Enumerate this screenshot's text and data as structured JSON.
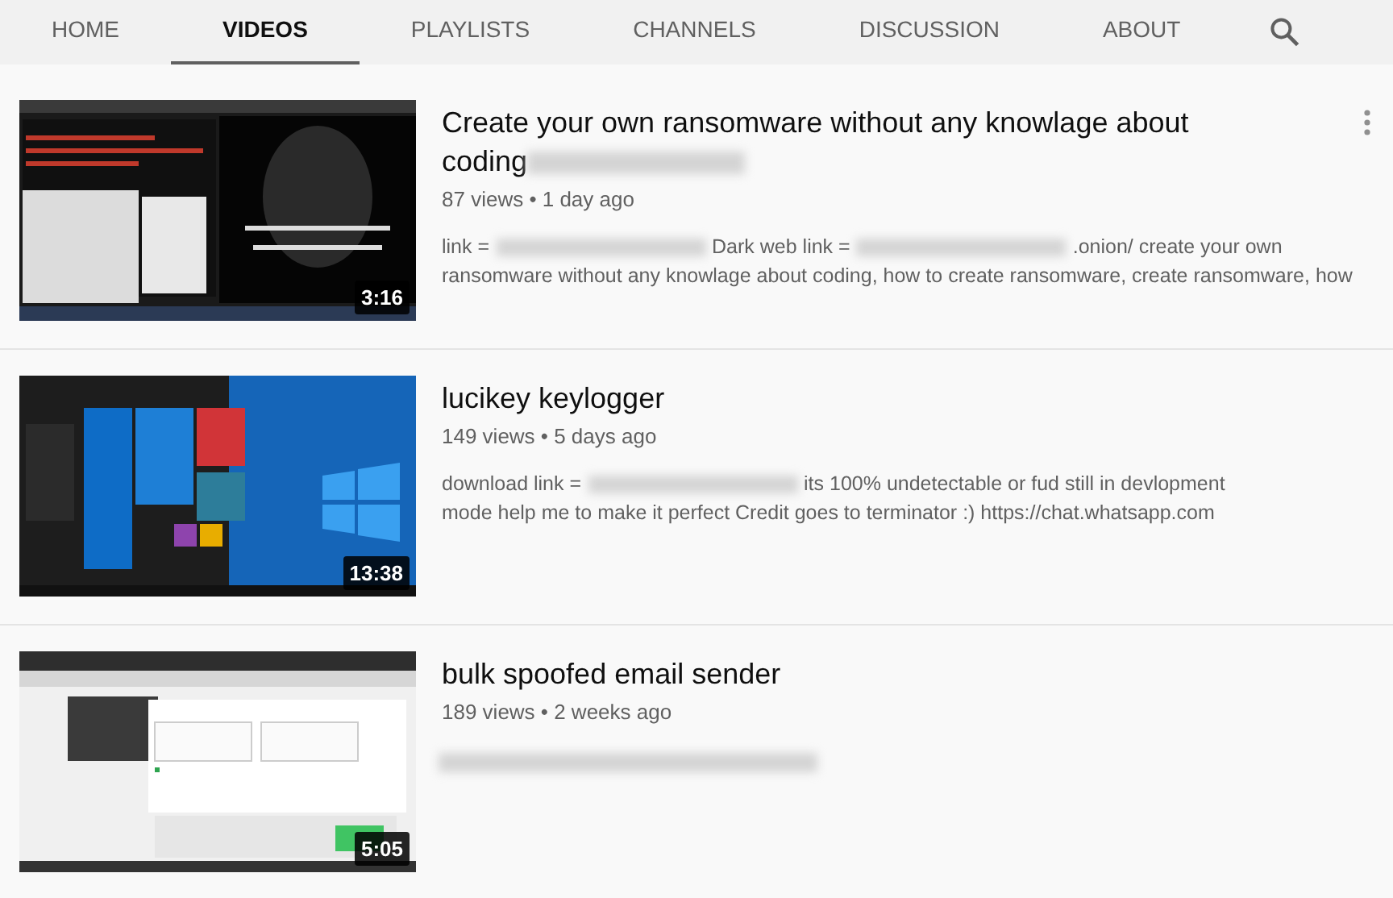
{
  "tabs": [
    {
      "label": "HOME",
      "selected": false
    },
    {
      "label": "VIDEOS",
      "selected": true
    },
    {
      "label": "PLAYLISTS",
      "selected": false
    },
    {
      "label": "CHANNELS",
      "selected": false
    },
    {
      "label": "DISCUSSION",
      "selected": false
    },
    {
      "label": "ABOUT",
      "selected": false
    }
  ],
  "videos": [
    {
      "thumbnail": {
        "kind": "picture"
      },
      "duration": "3:16",
      "title": [
        {
          "kind": "text",
          "text": "Create your own ransomware without any knowlage about coding"
        },
        {
          "kind": "redacted"
        }
      ],
      "meta": "87 views • 1 day ago",
      "menu": true,
      "description": [
        [
          {
            "kind": "text",
            "text": "link ="
          },
          {
            "kind": "redacted"
          },
          {
            "kind": "text",
            "text": "Dark web link ="
          },
          {
            "kind": "redacted"
          },
          {
            "kind": "text",
            "text": ".onion/ create your own"
          }
        ],
        [
          {
            "kind": "text",
            "text": "ransomware without any knowlage about coding, how to create ransomware, create ransomware, how"
          }
        ]
      ]
    },
    {
      "thumbnail": {
        "kind": "picture"
      },
      "duration": "13:38",
      "title": [
        {
          "kind": "text",
          "text": "lucikey keylogger"
        }
      ],
      "meta": "149 views • 5 days ago",
      "menu": false,
      "description": [
        [
          {
            "kind": "text",
            "text": "download link ="
          },
          {
            "kind": "redacted"
          },
          {
            "kind": "text",
            "text": "its 100% undetectable or fud still in devlopment"
          }
        ],
        [
          {
            "kind": "text",
            "text": "mode help me to make it perfect Credit goes to terminator :) https://chat.whatsapp.com"
          }
        ]
      ]
    },
    {
      "thumbnail": {
        "kind": "picture"
      },
      "duration": "5:05",
      "title": [
        {
          "kind": "text",
          "text": "bulk spoofed email sender"
        }
      ],
      "meta": "189 views • 2 weeks ago",
      "menu": false,
      "description": [
        [
          {
            "kind": "redacted"
          }
        ]
      ]
    }
  ]
}
